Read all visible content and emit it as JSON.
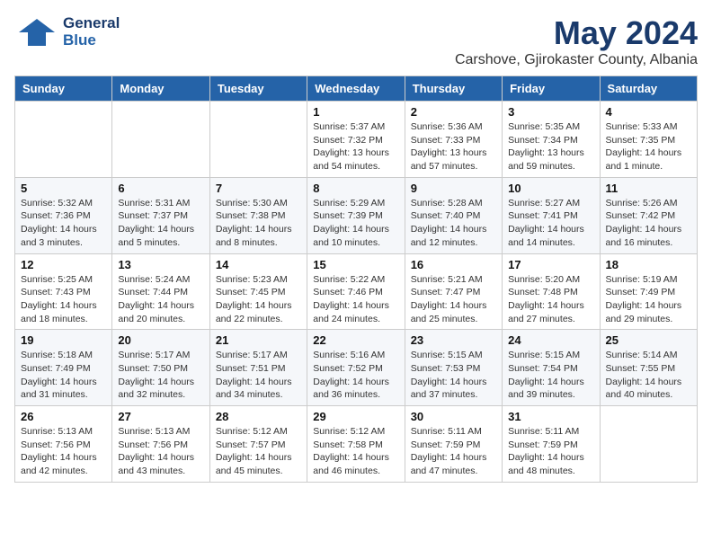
{
  "header": {
    "logo_line1": "General",
    "logo_line2": "Blue",
    "month_year": "May 2024",
    "location": "Carshove, Gjirokaster County, Albania"
  },
  "weekdays": [
    "Sunday",
    "Monday",
    "Tuesday",
    "Wednesday",
    "Thursday",
    "Friday",
    "Saturday"
  ],
  "weeks": [
    [
      {
        "day": "",
        "info": ""
      },
      {
        "day": "",
        "info": ""
      },
      {
        "day": "",
        "info": ""
      },
      {
        "day": "1",
        "info": "Sunrise: 5:37 AM\nSunset: 7:32 PM\nDaylight: 13 hours\nand 54 minutes."
      },
      {
        "day": "2",
        "info": "Sunrise: 5:36 AM\nSunset: 7:33 PM\nDaylight: 13 hours\nand 57 minutes."
      },
      {
        "day": "3",
        "info": "Sunrise: 5:35 AM\nSunset: 7:34 PM\nDaylight: 13 hours\nand 59 minutes."
      },
      {
        "day": "4",
        "info": "Sunrise: 5:33 AM\nSunset: 7:35 PM\nDaylight: 14 hours\nand 1 minute."
      }
    ],
    [
      {
        "day": "5",
        "info": "Sunrise: 5:32 AM\nSunset: 7:36 PM\nDaylight: 14 hours\nand 3 minutes."
      },
      {
        "day": "6",
        "info": "Sunrise: 5:31 AM\nSunset: 7:37 PM\nDaylight: 14 hours\nand 5 minutes."
      },
      {
        "day": "7",
        "info": "Sunrise: 5:30 AM\nSunset: 7:38 PM\nDaylight: 14 hours\nand 8 minutes."
      },
      {
        "day": "8",
        "info": "Sunrise: 5:29 AM\nSunset: 7:39 PM\nDaylight: 14 hours\nand 10 minutes."
      },
      {
        "day": "9",
        "info": "Sunrise: 5:28 AM\nSunset: 7:40 PM\nDaylight: 14 hours\nand 12 minutes."
      },
      {
        "day": "10",
        "info": "Sunrise: 5:27 AM\nSunset: 7:41 PM\nDaylight: 14 hours\nand 14 minutes."
      },
      {
        "day": "11",
        "info": "Sunrise: 5:26 AM\nSunset: 7:42 PM\nDaylight: 14 hours\nand 16 minutes."
      }
    ],
    [
      {
        "day": "12",
        "info": "Sunrise: 5:25 AM\nSunset: 7:43 PM\nDaylight: 14 hours\nand 18 minutes."
      },
      {
        "day": "13",
        "info": "Sunrise: 5:24 AM\nSunset: 7:44 PM\nDaylight: 14 hours\nand 20 minutes."
      },
      {
        "day": "14",
        "info": "Sunrise: 5:23 AM\nSunset: 7:45 PM\nDaylight: 14 hours\nand 22 minutes."
      },
      {
        "day": "15",
        "info": "Sunrise: 5:22 AM\nSunset: 7:46 PM\nDaylight: 14 hours\nand 24 minutes."
      },
      {
        "day": "16",
        "info": "Sunrise: 5:21 AM\nSunset: 7:47 PM\nDaylight: 14 hours\nand 25 minutes."
      },
      {
        "day": "17",
        "info": "Sunrise: 5:20 AM\nSunset: 7:48 PM\nDaylight: 14 hours\nand 27 minutes."
      },
      {
        "day": "18",
        "info": "Sunrise: 5:19 AM\nSunset: 7:49 PM\nDaylight: 14 hours\nand 29 minutes."
      }
    ],
    [
      {
        "day": "19",
        "info": "Sunrise: 5:18 AM\nSunset: 7:49 PM\nDaylight: 14 hours\nand 31 minutes."
      },
      {
        "day": "20",
        "info": "Sunrise: 5:17 AM\nSunset: 7:50 PM\nDaylight: 14 hours\nand 32 minutes."
      },
      {
        "day": "21",
        "info": "Sunrise: 5:17 AM\nSunset: 7:51 PM\nDaylight: 14 hours\nand 34 minutes."
      },
      {
        "day": "22",
        "info": "Sunrise: 5:16 AM\nSunset: 7:52 PM\nDaylight: 14 hours\nand 36 minutes."
      },
      {
        "day": "23",
        "info": "Sunrise: 5:15 AM\nSunset: 7:53 PM\nDaylight: 14 hours\nand 37 minutes."
      },
      {
        "day": "24",
        "info": "Sunrise: 5:15 AM\nSunset: 7:54 PM\nDaylight: 14 hours\nand 39 minutes."
      },
      {
        "day": "25",
        "info": "Sunrise: 5:14 AM\nSunset: 7:55 PM\nDaylight: 14 hours\nand 40 minutes."
      }
    ],
    [
      {
        "day": "26",
        "info": "Sunrise: 5:13 AM\nSunset: 7:56 PM\nDaylight: 14 hours\nand 42 minutes."
      },
      {
        "day": "27",
        "info": "Sunrise: 5:13 AM\nSunset: 7:56 PM\nDaylight: 14 hours\nand 43 minutes."
      },
      {
        "day": "28",
        "info": "Sunrise: 5:12 AM\nSunset: 7:57 PM\nDaylight: 14 hours\nand 45 minutes."
      },
      {
        "day": "29",
        "info": "Sunrise: 5:12 AM\nSunset: 7:58 PM\nDaylight: 14 hours\nand 46 minutes."
      },
      {
        "day": "30",
        "info": "Sunrise: 5:11 AM\nSunset: 7:59 PM\nDaylight: 14 hours\nand 47 minutes."
      },
      {
        "day": "31",
        "info": "Sunrise: 5:11 AM\nSunset: 7:59 PM\nDaylight: 14 hours\nand 48 minutes."
      },
      {
        "day": "",
        "info": ""
      }
    ]
  ]
}
